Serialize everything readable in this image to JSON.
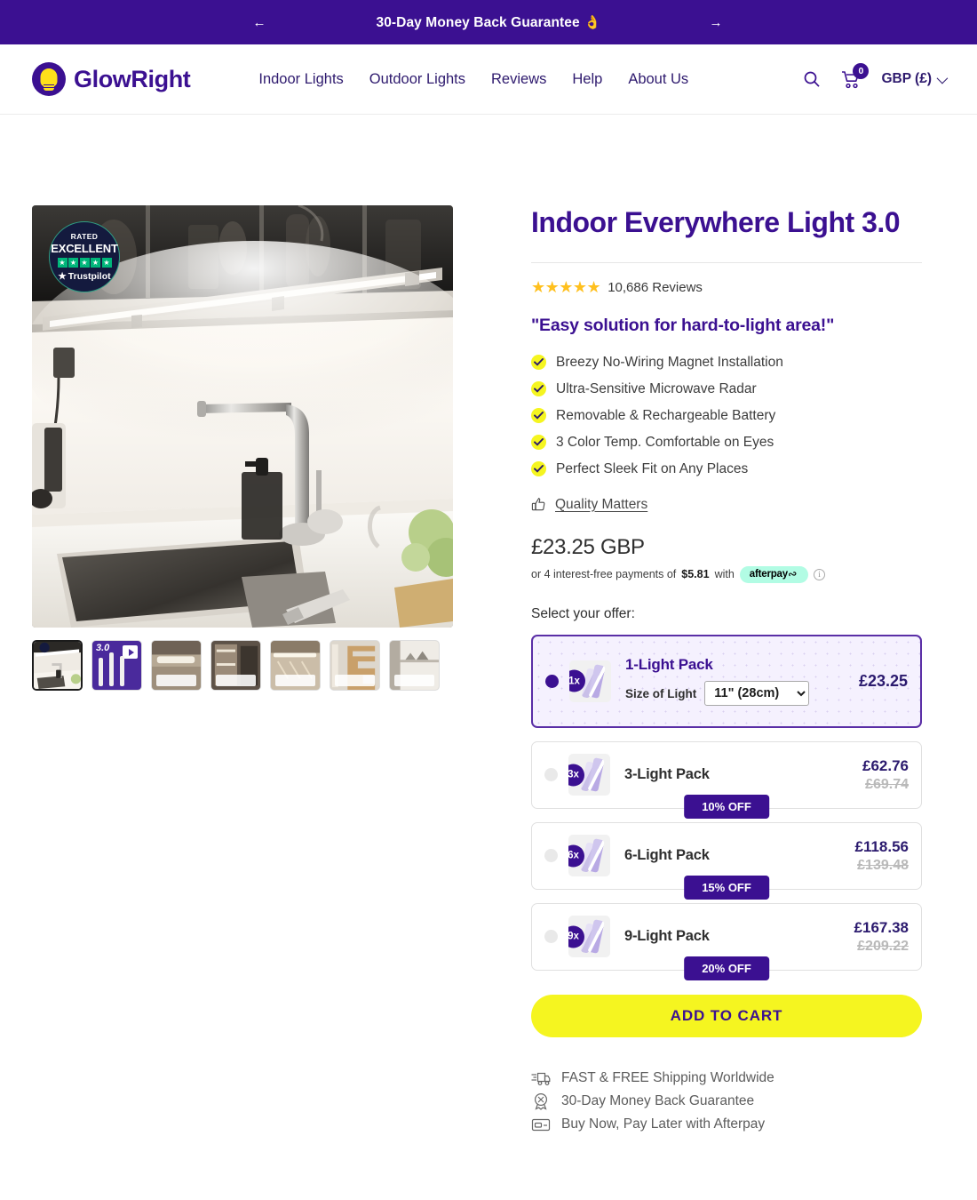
{
  "announcement": {
    "text": "30-Day Money Back Guarantee",
    "emoji": "👌",
    "prev_label": "←",
    "next_label": "→"
  },
  "header": {
    "brand_name": "GlowRight",
    "nav": [
      {
        "label": "Indoor Lights"
      },
      {
        "label": "Outdoor Lights"
      },
      {
        "label": "Reviews"
      },
      {
        "label": "Help"
      },
      {
        "label": "About Us"
      }
    ],
    "cart_count": "0",
    "currency": "GBP (£)"
  },
  "gallery": {
    "trustpilot": {
      "rated": "RATED",
      "excellent": "EXCELLENT",
      "name": "Trustpilot",
      "stars": 5
    },
    "thumbnails": [
      {
        "name": "kitchen-sink",
        "type": "image",
        "active": true
      },
      {
        "name": "product-video",
        "type": "video",
        "video_label": "3.0"
      },
      {
        "name": "under-cabinet",
        "type": "image"
      },
      {
        "name": "pantry-shelves",
        "type": "image"
      },
      {
        "name": "wardrobe-rail",
        "type": "image"
      },
      {
        "name": "staircase",
        "type": "image"
      },
      {
        "name": "display-shelf",
        "type": "image"
      }
    ]
  },
  "product": {
    "title": "Indoor Everywhere Light 3.0",
    "rating_stars": "★★★★★",
    "reviews": "10,686 Reviews",
    "tagline": "\"Easy solution for hard-to-light area!\"",
    "features": [
      {
        "label": "Breezy No-Wiring Magnet Installation"
      },
      {
        "label": "Ultra-Sensitive Microwave Radar"
      },
      {
        "label": "Removable & Rechargeable Battery"
      },
      {
        "label": "3 Color Temp. Comfortable on Eyes"
      },
      {
        "label": "Perfect Sleek Fit on Any Places"
      }
    ],
    "quality_link": "Quality Matters",
    "price": "£23.25 GBP",
    "installment_prefix": "or 4 interest-free payments of",
    "installment_amount": "$5.81",
    "installment_with": "with",
    "afterpay_label": "afterpay",
    "select_offer_label": "Select your offer:"
  },
  "offers": [
    {
      "qty_badge": "1x",
      "name": "1-Light Pack",
      "price": "£23.25",
      "compare_price": null,
      "discount": null,
      "selected": true,
      "size_label": "Size of Light",
      "size_value": "11\" (28cm)",
      "size_options": [
        "11\" (28cm)"
      ]
    },
    {
      "qty_badge": "3x",
      "name": "3-Light Pack",
      "price": "£62.76",
      "compare_price": "£69.74",
      "discount": "10% OFF",
      "selected": false
    },
    {
      "qty_badge": "6x",
      "name": "6-Light Pack",
      "price": "£118.56",
      "compare_price": "£139.48",
      "discount": "15% OFF",
      "selected": false
    },
    {
      "qty_badge": "9x",
      "name": "9-Light Pack",
      "price": "£167.38",
      "compare_price": "£209.22",
      "discount": "20% OFF",
      "selected": false
    }
  ],
  "cta": {
    "label": "ADD TO CART"
  },
  "trust_badges": [
    {
      "icon": "truck-icon",
      "label": "FAST & FREE Shipping Worldwide"
    },
    {
      "icon": "guarantee-badge-icon",
      "label": "30-Day Money Back Guarantee"
    },
    {
      "icon": "credit-card-icon",
      "label": "Buy Now, Pay Later with Afterpay"
    }
  ],
  "colors": {
    "brand_purple": "#3b1091",
    "accent_yellow": "#f5f520",
    "afterpay_mint": "#b2fce4",
    "star_gold": "#ffc01e",
    "trustpilot_green": "#00b67a"
  }
}
